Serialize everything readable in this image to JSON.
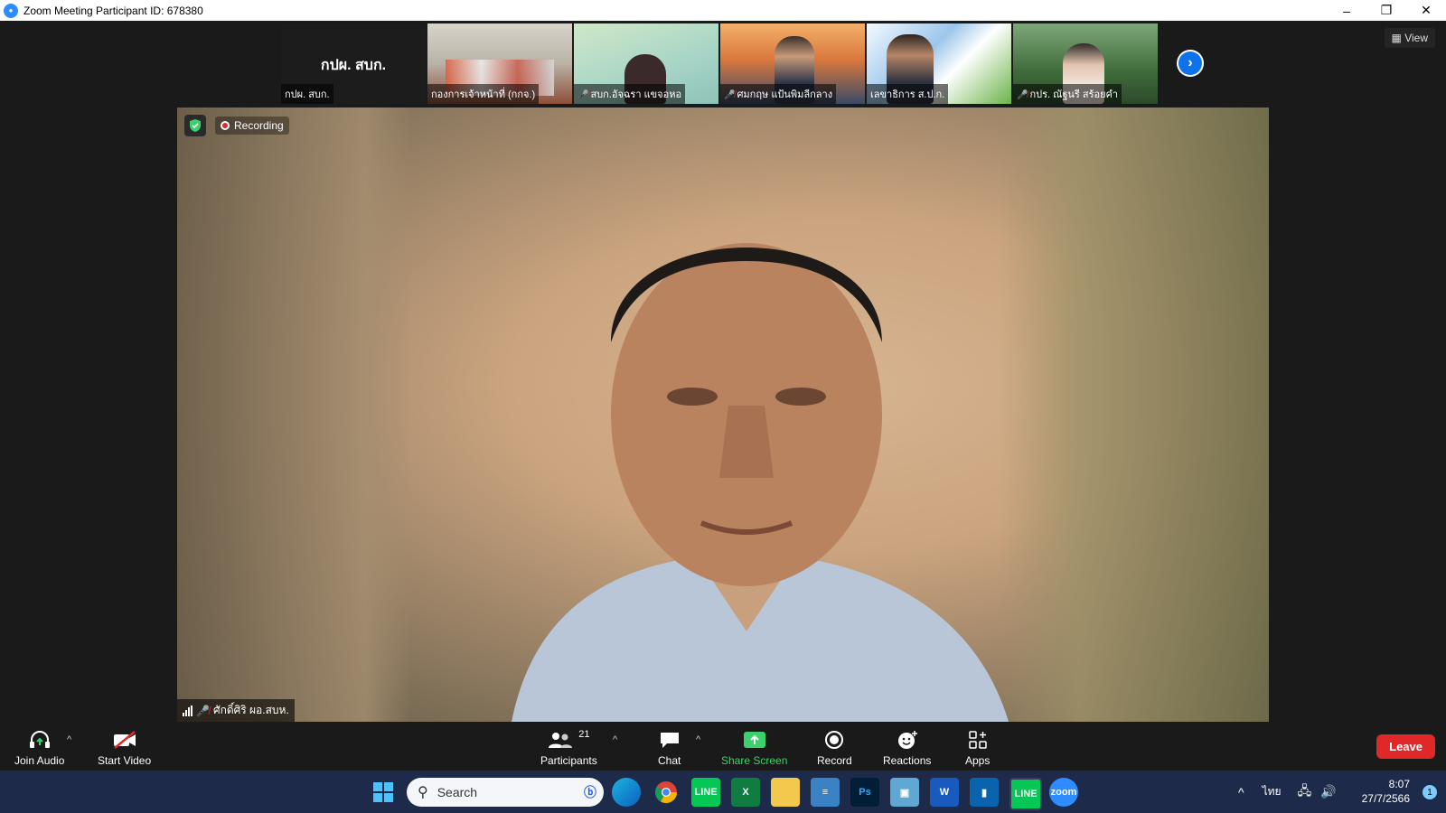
{
  "window": {
    "title": "Zoom Meeting Participant ID: 678380",
    "minimize": "–",
    "maximize": "❐",
    "close": "✕"
  },
  "gallery": {
    "tiles": [
      {
        "name": "กปผ. สบก.",
        "big_text": "กปผ. สบก.",
        "muted": false
      },
      {
        "name": "กองการเจ้าหน้าที่ (กกจ.)",
        "muted": false
      },
      {
        "name": "สบก.อัจฉรา แขจอหอ",
        "muted": true
      },
      {
        "name": "ศมกฤษ แป้นพิมลีกลาง",
        "muted": true
      },
      {
        "name": "เลขาธิการ ส.ป.ก.",
        "muted": false
      },
      {
        "name": "กปร. ณัฐนรี สร้อยคำ",
        "muted": true
      }
    ],
    "next_label": "›",
    "view_label": "View"
  },
  "main": {
    "recording_label": "Recording",
    "speaker_name": "ศักดิ์ศิริ ผอ.สบห.",
    "speaker_muted": true
  },
  "toolbar": {
    "join_audio": "Join Audio",
    "start_video": "Start Video",
    "participants": "Participants",
    "participants_count": "21",
    "chat": "Chat",
    "share_screen": "Share Screen",
    "record": "Record",
    "reactions": "Reactions",
    "apps": "Apps",
    "leave": "Leave",
    "caret": "^"
  },
  "taskbar": {
    "search_placeholder": "Search",
    "language": "ไทย",
    "time": "8:07",
    "date": "27/7/2566",
    "notification_count": "1"
  },
  "colors": {
    "accent": "#0e72ed",
    "leave": "#e02828",
    "share_green": "#3dd16d",
    "taskbar": "#1d2a4a"
  }
}
